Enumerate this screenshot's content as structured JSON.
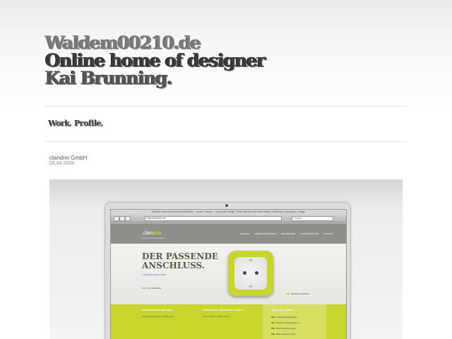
{
  "site": {
    "title_line1": "Waldem00210.de",
    "title_line2": "Online home of designer",
    "title_line3": "Kai Brunning."
  },
  "nav": {
    "work": "Work",
    "sep": ",",
    "profile": "Profile",
    "sep2": ","
  },
  "entry": {
    "title": "clandrei GmbH",
    "date": "06.04.2008"
  },
  "screenshot": {
    "window_title": "clandrei Unternehmenskommunikation - Kassel, Hessen - Corporate Design, Print, Internet und Neue Medien, Werbung, Konzeption, Design",
    "url": "http://clandrei.de/",
    "search_placeholder": "Google",
    "logo_prefix": ".clan",
    "logo_suffix": "drei",
    "tagline": "Unternehmenskommunikation",
    "menu": [
      "LEISTUNG",
      "OBJEKTSTRATEGIEN",
      "REFERENZEN",
      "DOKUMENTATION",
      "KONTAKT"
    ],
    "headline_1": "DER PASSENDE",
    "headline_2": "ANSCHLUSS.",
    "hero_copy": "6 JAHRE AUF DER SCHIENE",
    "hero_link": "ZUR HOMEPAGE",
    "hero_link2": "REIHEFOLGENREIHE",
    "col1_h": "KOMMUNIKATION UND MEHR",
    "col1_t": "Seit 2002 ist das Team von clandrei aktiv.",
    "col2_h": "STRATEGISCH, EINZIGARTIG, EFFEKTIV",
    "col2_t": "Was wir machen, machen wir gut.",
    "col3_h": "WORK UND KUNDEN",
    "col3_items": [
      "Konzeption Webdesign Ne...",
      "Beispiele im Prüfungsbereich...",
      "Kassel Corporate Design...",
      "Bildkonzepte Kommunik..."
    ],
    "accent_color": "#c8d52c"
  }
}
